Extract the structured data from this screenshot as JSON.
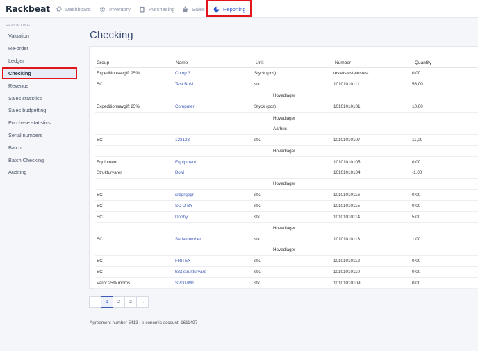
{
  "app": {
    "brand": "Rackbeat"
  },
  "nav": {
    "items": [
      {
        "label": "Dashboard",
        "icon": "rocket-icon"
      },
      {
        "label": "Inventory",
        "icon": "globe-icon"
      },
      {
        "label": "Purchasing",
        "icon": "clipboard-icon"
      },
      {
        "label": "Sales",
        "icon": "basket-icon"
      },
      {
        "label": "Reporting",
        "icon": "pie-chart-icon",
        "active": true
      }
    ]
  },
  "sidebar": {
    "section": "REPORTING",
    "items": [
      {
        "label": "Valuation"
      },
      {
        "label": "Re-order"
      },
      {
        "label": "Ledger"
      },
      {
        "label": "Checking",
        "active": true
      },
      {
        "label": "Revenue"
      },
      {
        "label": "Sales statistics"
      },
      {
        "label": "Sales budgetting"
      },
      {
        "label": "Purchase statistics"
      },
      {
        "label": "Serial numbers"
      },
      {
        "label": "Batch"
      },
      {
        "label": "Batch Checking"
      },
      {
        "label": "Auditing"
      }
    ]
  },
  "page": {
    "title": "Checking"
  },
  "table": {
    "columns": [
      "Group",
      "Name",
      "Unit",
      "Number",
      "Quantity"
    ],
    "rows": [
      {
        "group": "Expeditionsavgift 25%",
        "name": "Comp 3",
        "unit": "Styck (pcs)",
        "number": "testetstestetestest",
        "quantity": "0,00"
      },
      {
        "group": "SC",
        "name": "Test BoM",
        "unit": "stk.",
        "number": "10101010111",
        "quantity": "56,00"
      },
      {
        "location": "Hovedlager"
      },
      {
        "group": "Expeditionsavgift 25%",
        "name": "Computer",
        "unit": "Styck (pcs)",
        "number": "10101010101",
        "quantity": "10,00"
      },
      {
        "location": "Hovedlager"
      },
      {
        "location": "Aarhus"
      },
      {
        "group": "SC",
        "name": "123123",
        "unit": "stk.",
        "number": "10101010107",
        "quantity": "11,00"
      },
      {
        "location": "Hovedlager"
      },
      {
        "group": "Equipment",
        "name": "Equipment",
        "unit": "",
        "number": "10101010105",
        "quantity": "0,00"
      },
      {
        "group": "Strukturvarer",
        "name": "BoM",
        "unit": "",
        "number": "10101010104",
        "quantity": "-1,00"
      },
      {
        "location": "Hovedlager"
      },
      {
        "group": "SC",
        "name": "srdgrgegr",
        "unit": "stk.",
        "number": "10101010116",
        "quantity": "0,00"
      },
      {
        "group": "SC",
        "name": "SC O BY",
        "unit": "stk.",
        "number": "10101010115",
        "quantity": "0,00"
      },
      {
        "group": "SC",
        "name": "Dooby",
        "unit": "stk.",
        "number": "10101010114",
        "quantity": "5,00"
      },
      {
        "location": "Hovedlager"
      },
      {
        "group": "SC",
        "name": "Serialnumber",
        "unit": "stk.",
        "number": "10101010113",
        "quantity": "1,00"
      },
      {
        "location": "Hovedlager"
      },
      {
        "group": "SC",
        "name": "FRITEXT",
        "unit": "stk.",
        "number": "10101010112",
        "quantity": "0,00"
      },
      {
        "group": "SC",
        "name": "test strukturvare",
        "unit": "stk.",
        "number": "10101010110",
        "quantity": "0,00"
      },
      {
        "group": "Varor 25% moms",
        "name": "SV007M1",
        "unit": "stk.",
        "number": "10101010109",
        "quantity": "0,00"
      }
    ]
  },
  "pagination": {
    "prev": "←",
    "pages": [
      "1",
      "2",
      "3"
    ],
    "current": "1",
    "next": "→"
  },
  "footer": {
    "text": "Agreement number 5413 | e-conomic account: 1611497"
  },
  "colors": {
    "accent": "#2e55c9",
    "highlight": "#e0161c"
  }
}
